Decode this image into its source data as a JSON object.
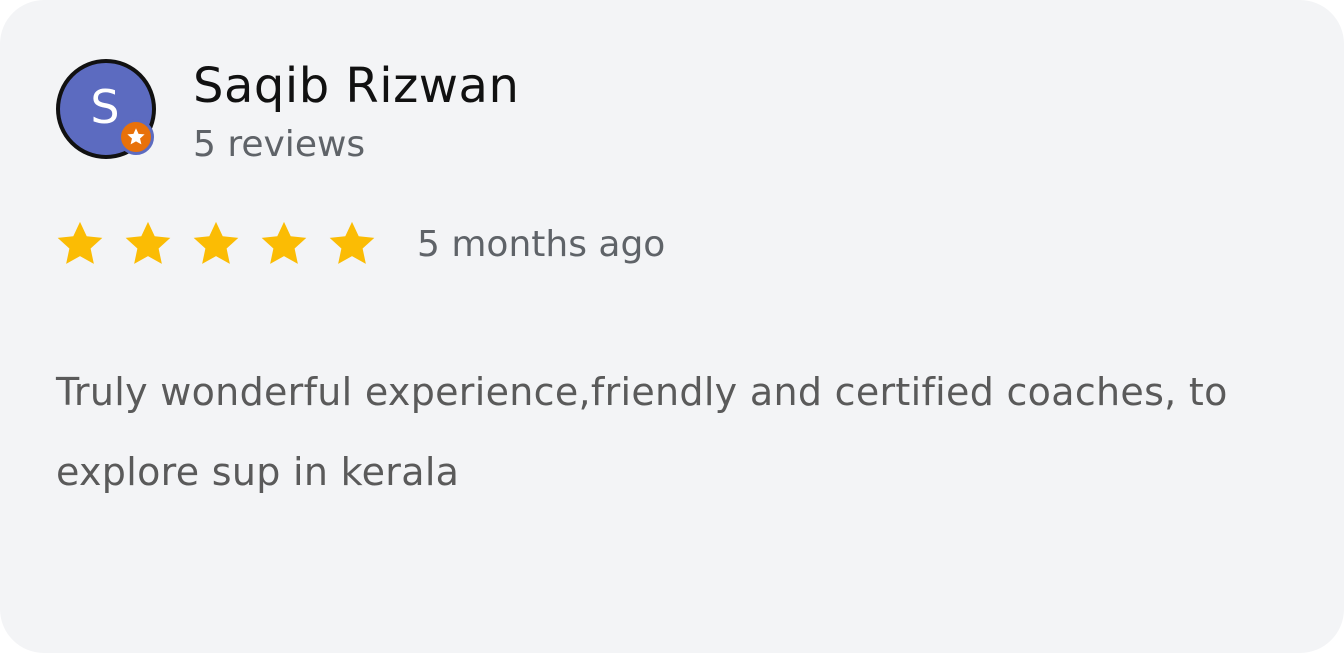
{
  "review": {
    "reviewer": {
      "name": "Saqib Rizwan",
      "initial": "S",
      "avatar_color": "#5c6bc0",
      "badge_icon": "local-guide-star-icon",
      "badge_color": "#e8710a",
      "reviews_count": "5 reviews"
    },
    "rating": {
      "stars": 5,
      "max": 5,
      "star_color": "#fbbc04",
      "star_icon": "star-icon"
    },
    "date": "5 months ago",
    "text": "Truly wonderful experience,friendly and certified coaches, to explore sup in kerala"
  }
}
